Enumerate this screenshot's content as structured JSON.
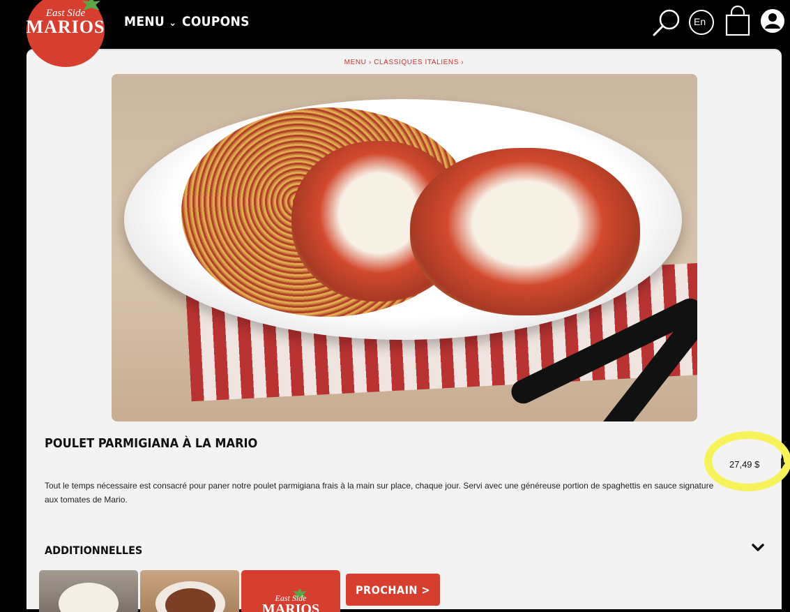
{
  "brand": {
    "logo_line1": "East Side",
    "logo_line2": "MARIOS",
    "color_primary": "#d63f2f",
    "color_highlight": "#f6f35a"
  },
  "nav": {
    "menu_label": "MENU",
    "coupons_label": "COUPONS",
    "language_label": "En",
    "icons": [
      "search-icon",
      "language-icon",
      "cart-icon",
      "account-icon"
    ]
  },
  "breadcrumb": {
    "item1": "MENU",
    "item2": "CLASSIQUES ITALIENS",
    "separator": "›"
  },
  "dish": {
    "title": "POULET PARMIGIANA À LA MARIO",
    "price": "27,49 $",
    "description": "Tout le temps nécessaire est consacré pour paner notre poulet parmigiana frais à la main sur place, chaque jour. Servi avec une généreuse portion de spaghettis en sauce signature aux tomates de Mario."
  },
  "additionals": {
    "title": "ADDITIONNELLES",
    "next_label": "PROCHAIN >",
    "thumb_logo_line1": "East Side",
    "thumb_logo_line2": "MARIOS"
  }
}
